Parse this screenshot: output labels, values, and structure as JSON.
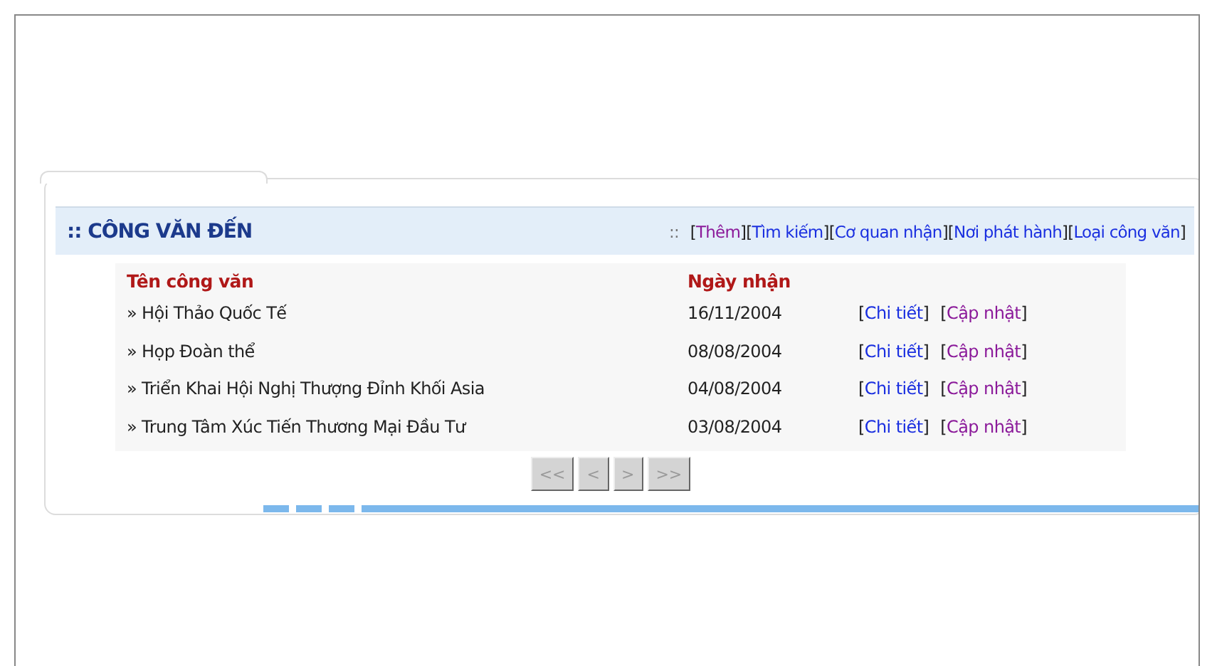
{
  "panel": {
    "title": ":: CÔNG VĂN ĐẾN",
    "links_prefix": "::",
    "bracket_open": "[",
    "bracket_close": "]",
    "links": [
      {
        "label": "Thêm",
        "visited": true
      },
      {
        "label": "Tìm kiếm",
        "visited": false
      },
      {
        "label": "Cơ quan nhận",
        "visited": false
      },
      {
        "label": "Nơi phát hành",
        "visited": false
      },
      {
        "label": "Loại công văn",
        "visited": false
      }
    ]
  },
  "table": {
    "columns": [
      "Tên công văn",
      "Ngày nhận"
    ],
    "rows": [
      {
        "name": "» Hội Thảo Quốc Tế",
        "date": "16/11/2004",
        "actions": [
          {
            "label": "Chi tiết",
            "visited": false
          },
          {
            "label": "Cập nhật",
            "visited": true
          }
        ]
      },
      {
        "name": "» Họp Đoàn thể",
        "date": "08/08/2004",
        "actions": [
          {
            "label": "Chi tiết",
            "visited": false
          },
          {
            "label": "Cập nhật",
            "visited": true
          }
        ]
      },
      {
        "name": "» Triển Khai Hội Nghị Thượng Đỉnh Khối Asia",
        "date": "04/08/2004",
        "actions": [
          {
            "label": "Chi tiết",
            "visited": false
          },
          {
            "label": "Cập nhật",
            "visited": true
          }
        ]
      },
      {
        "name": "» Trung Tâm Xúc Tiến Thương Mại Đầu Tư",
        "date": "03/08/2004",
        "actions": [
          {
            "label": "Chi tiết",
            "visited": false
          },
          {
            "label": "Cập nhật",
            "visited": true
          }
        ]
      }
    ]
  },
  "pager": [
    {
      "label": "<<",
      "disabled": true
    },
    {
      "label": "<",
      "disabled": true
    },
    {
      "label": ">",
      "disabled": true
    },
    {
      "label": ">>",
      "disabled": true
    }
  ]
}
